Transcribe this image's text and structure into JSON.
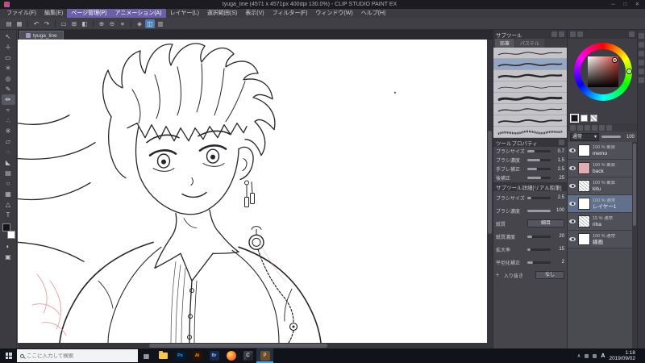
{
  "window": {
    "title": "tyuga_line (4571 x 4571px 400dpi 130.0%) - CLIP STUDIO PAINT EX",
    "minimize": "─",
    "maximize": "□",
    "close": "✕"
  },
  "menubar": {
    "items": [
      "ファイル(F)",
      "編集(E)",
      "ページ管理(P)",
      "アニメーション(A)",
      "レイヤー(L)",
      "選択範囲(S)",
      "表示(V)",
      "フィルター(F)",
      "ウィンドウ(W)",
      "ヘルプ(H)"
    ]
  },
  "canvas": {
    "tab": "tyuga_line"
  },
  "subtool": {
    "title": "サブツール",
    "tabs": [
      "鉛筆",
      "パステル"
    ]
  },
  "tool_property": {
    "title": "ツールプロパティ",
    "rows": [
      {
        "label": "ブラシサイズ",
        "value": "0.7"
      },
      {
        "label": "ブラシ濃度",
        "value": "1.5"
      },
      {
        "label": "手ブレ補正",
        "value": "2.5"
      },
      {
        "label": "後補正",
        "value": "25"
      }
    ]
  },
  "subtool_detail": {
    "title": "サブツール詳細[リアル鉛筆]",
    "rows": [
      {
        "label": "ブラシサイズ",
        "value": "2.5"
      },
      {
        "label": "ブラシ濃度",
        "value": "100"
      },
      {
        "label": "紙質",
        "value": "細目"
      },
      {
        "label": "紙質濃度",
        "value": "20"
      },
      {
        "label": "拡大率",
        "value": "15"
      },
      {
        "label": "平坦化補正",
        "value": "2"
      },
      {
        "label": "入り抜き",
        "value": "なし"
      }
    ]
  },
  "layer_panel": {
    "blend_mode": "通常",
    "opacity": "100",
    "layers": [
      {
        "opacity": "100 %",
        "blend": "乗算",
        "name": "memo"
      },
      {
        "opacity": "100 %",
        "blend": "乗算",
        "name": "back"
      },
      {
        "opacity": "100 %",
        "blend": "乗算",
        "name": "kitu"
      },
      {
        "opacity": "100 %",
        "blend": "通常",
        "name": "レイヤー1"
      },
      {
        "opacity": "15 %",
        "blend": "通常",
        "name": "riha"
      },
      {
        "opacity": "100 %",
        "blend": "通常",
        "name": "線画"
      }
    ]
  },
  "taskbar": {
    "search_placeholder": "ここに入力して検索",
    "photoshop": "Ps",
    "illustrator": "Ai",
    "bridge": "Br",
    "clip_studio": "C",
    "paint": "P",
    "ime": "A",
    "time": "1:18",
    "date": "2019/09/02"
  },
  "icons": {
    "toolbar": [
      "▤",
      "▦",
      "↶",
      "↷",
      "▭",
      "⊞",
      "◧",
      "⊕",
      "⊖",
      "≡",
      "◈",
      "◫",
      "▥"
    ],
    "tools": [
      "↖",
      "＋",
      "▭",
      "＊",
      "◎",
      "✎",
      "✏",
      "≈",
      "∴",
      "※",
      "▱",
      "◌",
      "◣",
      "▤",
      "○",
      "▦",
      "△",
      "T"
    ],
    "tools_bottom": [
      "◐",
      "▣"
    ],
    "blend_caret": "▾",
    "tray_chevron": "∧",
    "taskview": "▦"
  },
  "colors": {
    "accent_blue": "#4a7fb5",
    "selected_color": "#d23a2e",
    "sketch_pink": "#e2a0a6"
  }
}
